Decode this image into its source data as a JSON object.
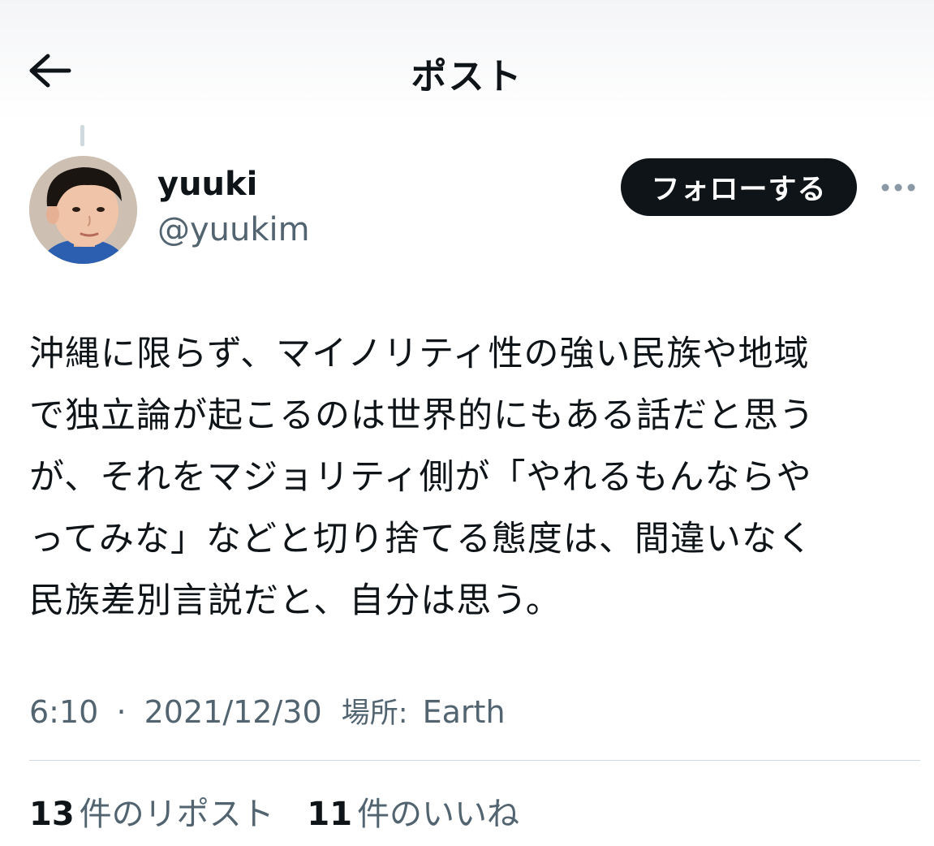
{
  "header": {
    "title": "ポスト",
    "back_icon": "arrow-left-icon"
  },
  "author": {
    "display_name": "yuuki",
    "handle": "@yuukim",
    "follow_label": "フォローする",
    "more_icon": "more-horizontal-icon"
  },
  "post": {
    "text": "沖縄に限らず、マイノリティ性の強い民族や地域\nで独立論が起こるのは世界的にもある話だと思う\nが、それをマジョリティ側が「やれるもんならや\nってみな」などと切り捨てる態度は、間違いなく\n民族差別言説だと、自分は思う。",
    "time": "6:10",
    "separator": "·",
    "date": "2021/12/30",
    "location_label": "場所:",
    "location": "Earth"
  },
  "stats": {
    "reposts_count": "13",
    "reposts_label": "件のリポスト",
    "likes_count": "11",
    "likes_label": "件のいいね"
  },
  "colors": {
    "text_primary": "#0f1419",
    "text_secondary": "#536471",
    "follow_bg": "#0f1419",
    "divider": "#cfd9de"
  }
}
